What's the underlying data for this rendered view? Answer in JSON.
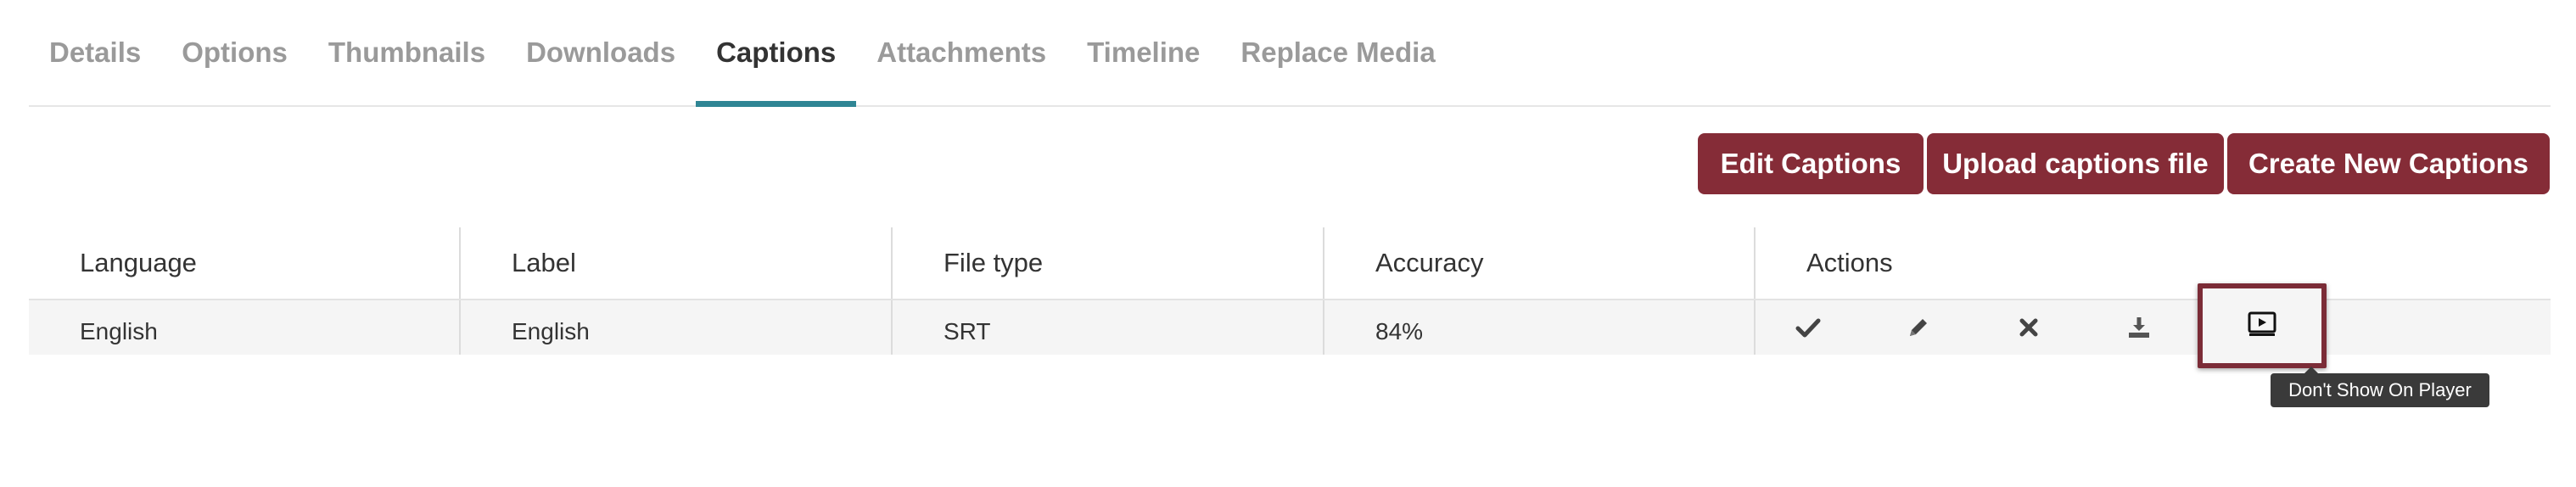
{
  "tabs": [
    {
      "label": "Details",
      "active": false
    },
    {
      "label": "Options",
      "active": false
    },
    {
      "label": "Thumbnails",
      "active": false
    },
    {
      "label": "Downloads",
      "active": false
    },
    {
      "label": "Captions",
      "active": true
    },
    {
      "label": "Attachments",
      "active": false
    },
    {
      "label": "Timeline",
      "active": false
    },
    {
      "label": "Replace Media",
      "active": false
    }
  ],
  "toolbar": {
    "edit_label": "Edit Captions",
    "upload_label": "Upload captions file",
    "create_label": "Create New Captions"
  },
  "table": {
    "headers": [
      "Language",
      "Label",
      "File type",
      "Accuracy",
      "Actions"
    ],
    "rows": [
      {
        "language": "English",
        "label": "English",
        "file_type": "SRT",
        "accuracy": "84%"
      }
    ]
  },
  "actions": [
    {
      "name": "set-default-icon",
      "icon": "check"
    },
    {
      "name": "edit-icon",
      "icon": "pencil"
    },
    {
      "name": "delete-icon",
      "icon": "x"
    },
    {
      "name": "download-icon",
      "icon": "download"
    },
    {
      "name": "player-visibility-icon",
      "icon": "player"
    }
  ],
  "tooltip": "Don't Show On Player",
  "colors": {
    "brand": "#852c37",
    "active_tab_underline": "#2f8594",
    "highlight_border": "#7b2c37",
    "tooltip_bg": "#3a3a3a"
  }
}
